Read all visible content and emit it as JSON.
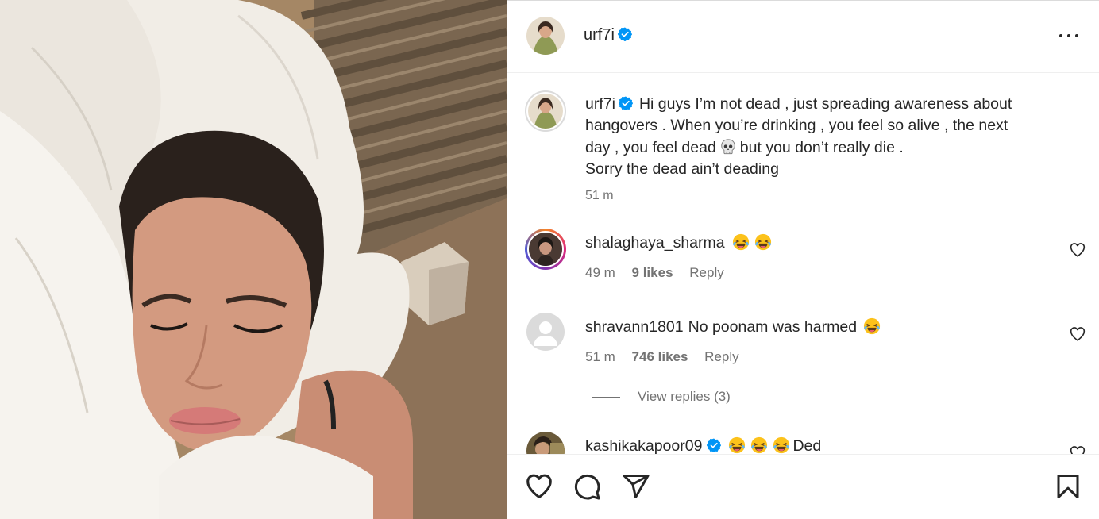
{
  "post": {
    "username": "urf7i",
    "more_label": "More options",
    "caption": {
      "username": "urf7i",
      "line1": "Hi guys I’m not dead , just spreading awareness about",
      "line2": "hangovers . When you’re drinking , you feel so alive , the next",
      "line3a": "day , you feel dead",
      "line3b": "but you don’t really die .",
      "line4": "Sorry the dead ain’t deading",
      "time": "51 m"
    }
  },
  "comments": [
    {
      "username": "shalaghaya_sharma",
      "text": "",
      "time": "49 m",
      "likes": "9 likes",
      "reply": "Reply"
    },
    {
      "username": "shravann1801",
      "text": "No poonam was harmed",
      "time": "51 m",
      "likes": "746 likes",
      "reply": "Reply"
    },
    {
      "username": "kashikakapoor09",
      "text": "Ded"
    }
  ],
  "view_replies": "View replies (3)",
  "colors": {
    "verified": "#0095f6",
    "text": "#262626",
    "muted": "#737373"
  },
  "icons": {
    "like": "heart-icon",
    "comment": "comment-bubble-icon",
    "share": "paper-plane-icon",
    "save": "bookmark-icon",
    "more": "ellipsis-icon",
    "verified": "verified-badge-icon",
    "emoji_laugh": "tears-of-joy-emoji",
    "emoji_skull": "skull-emoji"
  }
}
